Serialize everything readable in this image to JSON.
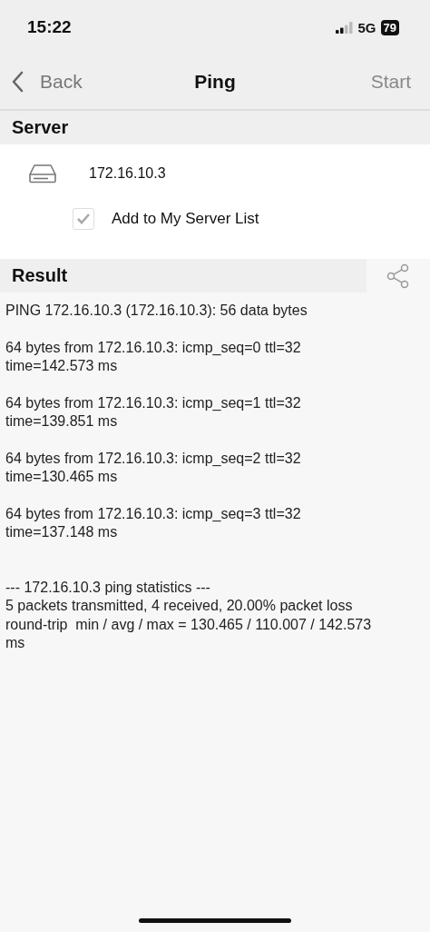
{
  "status_bar": {
    "time": "15:22",
    "network": "5G",
    "battery": "79"
  },
  "nav": {
    "back": "Back",
    "title": "Ping",
    "action": "Start"
  },
  "server": {
    "header": "Server",
    "address": "172.16.10.3",
    "add_to_list": {
      "label": "Add to My Server List",
      "checked": true
    }
  },
  "result": {
    "header": "Result",
    "output": [
      {
        "kind": "line",
        "lines": [
          "PING 172.16.10.3 (172.16.10.3): 56 data bytes"
        ]
      },
      {
        "kind": "line",
        "lines": [
          "64 bytes from 172.16.10.3: icmp_seq=0 ttl=32",
          "time=142.573 ms"
        ]
      },
      {
        "kind": "line",
        "lines": [
          "64 bytes from 172.16.10.3: icmp_seq=1 ttl=32",
          "time=139.851 ms"
        ]
      },
      {
        "kind": "line",
        "lines": [
          "64 bytes from 172.16.10.3: icmp_seq=2 ttl=32",
          "time=130.465 ms"
        ]
      },
      {
        "kind": "line",
        "lines": [
          "64 bytes from 172.16.10.3: icmp_seq=3 ttl=32",
          "time=137.148 ms"
        ]
      },
      {
        "kind": "summary",
        "lines": [
          "--- 172.16.10.3 ping statistics ---",
          "5 packets transmitted, 4 received, 20.00% packet loss",
          "round-trip  min / avg / max = 130.465 / 110.007 / 142.573",
          "ms"
        ]
      }
    ]
  }
}
